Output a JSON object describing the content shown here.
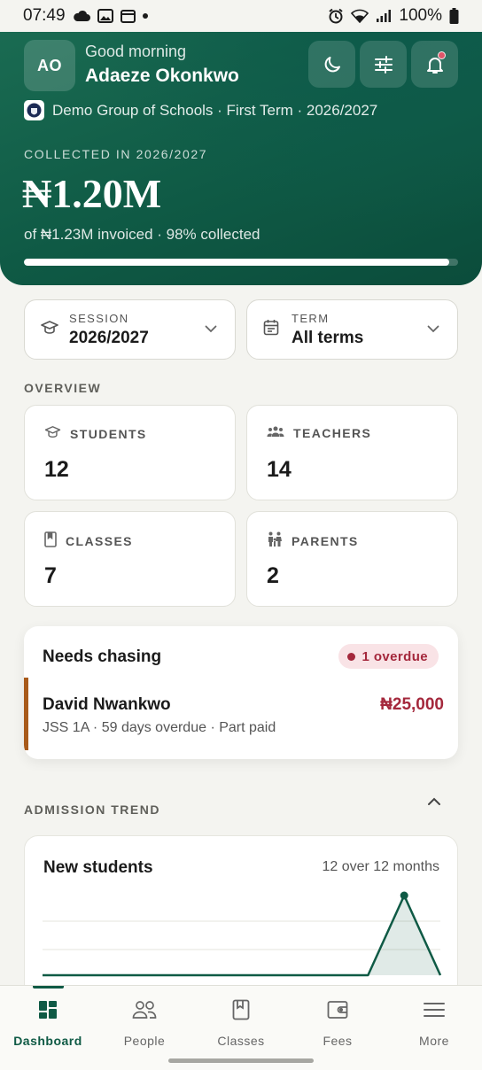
{
  "status_bar": {
    "time": "07:49",
    "battery": "100%"
  },
  "header": {
    "avatar_initials": "AO",
    "greeting": "Good morning",
    "user_name": "Adaeze Okonkwo",
    "school_line": "Demo Group of Schools · First Term · 2026/2027",
    "collected_label": "COLLECTED IN 2026/2027",
    "collected_amount": "₦1.20M",
    "invoiced_line": "of ₦1.23M invoiced · 98% collected",
    "collected_fraction": 0.98,
    "buttons": [
      "moon-icon",
      "sliders-icon",
      "bell-icon"
    ]
  },
  "filters": {
    "session": {
      "label": "SESSION",
      "value": "2026/2027"
    },
    "term": {
      "label": "TERM",
      "value": "All terms"
    }
  },
  "overview": {
    "label": "OVERVIEW",
    "stats": [
      {
        "label": "STUDENTS",
        "value": "12",
        "icon": "graduation-cap-icon"
      },
      {
        "label": "TEACHERS",
        "value": "14",
        "icon": "group-icon"
      },
      {
        "label": "CLASSES",
        "value": "7",
        "icon": "book-icon"
      },
      {
        "label": "PARENTS",
        "value": "2",
        "icon": "family-icon"
      }
    ]
  },
  "needs_chasing": {
    "title": "Needs chasing",
    "badge": "1 overdue",
    "items": [
      {
        "name": "David Nwankwo",
        "meta": "JSS 1A · 59 days overdue · Part paid",
        "amount": "₦25,000"
      }
    ]
  },
  "admission_trend": {
    "label": "ADMISSION TREND",
    "card_title": "New students",
    "card_subtitle": "12 over 12 months"
  },
  "chart_data": {
    "type": "area",
    "title": "New students",
    "x": [
      1,
      2,
      3,
      4,
      5,
      6,
      7,
      8,
      9,
      10,
      11,
      12
    ],
    "series": [
      {
        "values": [
          0,
          0,
          0,
          0,
          0,
          0,
          0,
          0,
          0,
          0,
          12,
          0
        ]
      }
    ],
    "ylim": [
      0,
      12
    ],
    "grid": true
  },
  "bottom_nav": {
    "items": [
      {
        "label": "Dashboard",
        "icon": "dashboard-icon",
        "active": true
      },
      {
        "label": "People",
        "icon": "people-icon",
        "active": false
      },
      {
        "label": "Classes",
        "icon": "book-icon",
        "active": false
      },
      {
        "label": "Fees",
        "icon": "wallet-icon",
        "active": false
      },
      {
        "label": "More",
        "icon": "menu-icon",
        "active": false
      }
    ]
  },
  "colors": {
    "brand": "#0f5a45",
    "overdue": "#a4283c",
    "accent_bar": "#a85a1a"
  }
}
